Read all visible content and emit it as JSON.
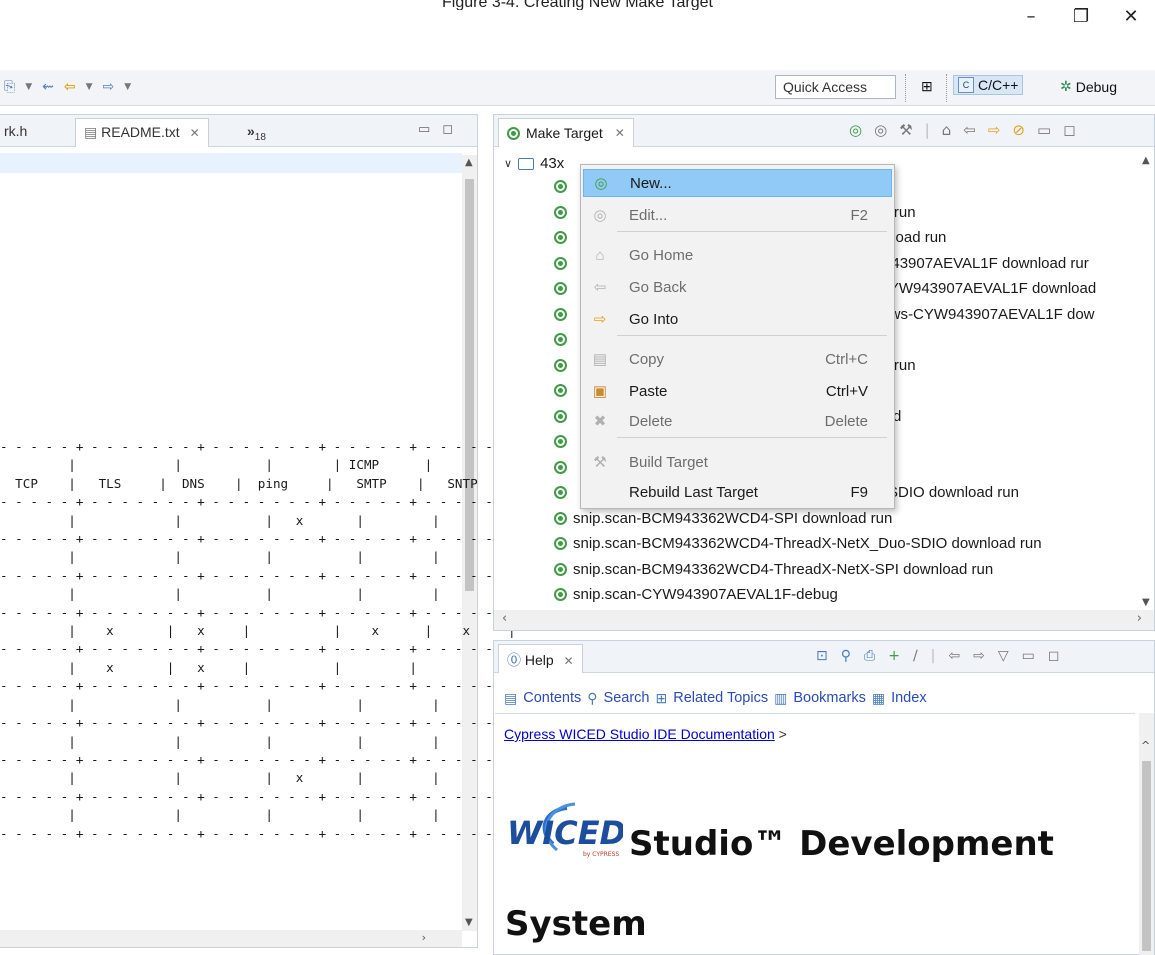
{
  "caption": "Figure 3-4. Creating New Make Target",
  "window_controls": {
    "minimize": "–",
    "restore": "❐",
    "close": "✕"
  },
  "toolbar": {
    "quick_access": "Quick Access",
    "perspectives": [
      {
        "label": "C/C++",
        "active": true
      },
      {
        "label": "Debug",
        "active": false
      }
    ]
  },
  "editor": {
    "tabs": [
      {
        "label": "rk.h"
      },
      {
        "label": "README.txt",
        "active": true,
        "close": "✕"
      }
    ],
    "overflow": "»",
    "overflow_count": "18",
    "table_text": "- - - - - + - - - - - - - + - - - - - - - + - - - - - + - - - - - - - - - + - - - - - - - - + - - - - - - - - +\n         |             |           |        | ICMP      |         |          |\n  TCP    |   TLS     |  DNS    |  ping     |   SMTP    |   SNTP   |\n- - - - - + - - - - - - - + - - - - - - - + - - - - - + - - - - - - - - - + - - - - - - - - + - - - - - - - - +\n         |             |           |   x       |         |          |\n- - - - - + - - - - - - - + - - - - - - - + - - - - - + - - - - - - - - - + - - - - - - - - + - - - - - - - - +\n         |             |           |           |         |          |\n- - - - - + - - - - - - - + - - - - - - - + - - - - - + - - - - - - - - - + - - - - - - - - + - - - - - - - - +\n         |             |           |           |         |          |\n- - - - - + - - - - - - - + - - - - - - - + - - - - - + - - - - - - - - - + - - - - - - - - + - - - - - - - - +\n         |    x       |   x     |           |    x      |    x     |\n- - - - - + - - - - - - - + - - - - - - - + - - - - - + - - - - - - - - - + - - - - - - - - + - - - - - - - - +\n         |    x       |   x     |           |         |          |\n- - - - - + - - - - - - - + - - - - - - - + - - - - - + - - - - - - - - - + - - - - - - - - + - - - - - - - - +\n         |             |           |           |         |          |\n- - - - - + - - - - - - - + - - - - - - - + - - - - - + - - - - - - - - - + - - - - - - - - + - - - - - - - - +\n         |             |           |           |         |          |\n- - - - - + - - - - - - - + - - - - - - - + - - - - - + - - - - - - - - - + - - - - - - - - + - - - - - - - - +\n         |             |           |   x       |         |          |\n- - - - - + - - - - - - - + - - - - - - - + - - - - - + - - - - - - - - - + - - - - - - - - + - - - - - - - - +\n         |             |           |           |         |          |\n- - - - - + - - - - - - - + - - - - - - - + - - - - - + - - - - - - - - - + - - - - - - - - + - - - - - - - - +"
  },
  "make_target": {
    "title": "Make Target",
    "close": "✕",
    "root": "43x",
    "partial_rows": [
      "",
      "ad run",
      "wnload run",
      "V943907AEVAL1F download rur",
      "-CYW943907AEVAL1F download",
      "_aws-CYW943907AEVAL1F dow",
      "run",
      "ad run",
      "",
      "load",
      "",
      "n",
      "P-SDIO download run"
    ],
    "rows": [
      "snip.scan-BCM943362WCD4-SPI download run",
      "snip.scan-BCM943362WCD4-ThreadX-NetX_Duo-SDIO download run",
      "snip.scan-BCM943362WCD4-ThreadX-NetX-SPI download run",
      "snip.scan-CYW943907AEVAL1F-debug"
    ]
  },
  "context_menu": {
    "items": [
      {
        "label": "New...",
        "shortcut": "",
        "selected": true,
        "disabled": false,
        "icon": "new-target-icon"
      },
      {
        "label": "Edit...",
        "shortcut": "F2",
        "disabled": true,
        "icon": "edit-target-icon"
      },
      {
        "label": "Go Home",
        "shortcut": "",
        "disabled": true,
        "icon": "home-icon"
      },
      {
        "label": "Go Back",
        "shortcut": "",
        "disabled": true,
        "icon": "back-arrow-icon"
      },
      {
        "label": "Go Into",
        "shortcut": "",
        "disabled": false,
        "icon": "forward-arrow-icon"
      },
      {
        "label": "Copy",
        "shortcut": "Ctrl+C",
        "disabled": true,
        "icon": "copy-icon"
      },
      {
        "label": "Paste",
        "shortcut": "Ctrl+V",
        "disabled": false,
        "icon": "paste-icon"
      },
      {
        "label": "Delete",
        "shortcut": "Delete",
        "disabled": true,
        "icon": "delete-icon"
      },
      {
        "label": "Build Target",
        "shortcut": "",
        "disabled": true,
        "icon": "build-icon"
      },
      {
        "label": "Rebuild Last Target",
        "shortcut": "F9",
        "disabled": false,
        "icon": ""
      }
    ]
  },
  "help": {
    "title": "Help",
    "close": "✕",
    "nav": [
      "Contents",
      "Search",
      "Related Topics",
      "Bookmarks",
      "Index"
    ],
    "breadcrumb_link": "Cypress WICED Studio IDE Documentation",
    "breadcrumb_sep": ">",
    "logo_text": "WICED",
    "logo_sub": "by CYPRESS",
    "heading_line1": "Studio™ Development",
    "heading_line2": "System"
  },
  "colors": {
    "accent": "#91c9f7",
    "target_green": "#3f9b46",
    "link": "#0000cc"
  }
}
